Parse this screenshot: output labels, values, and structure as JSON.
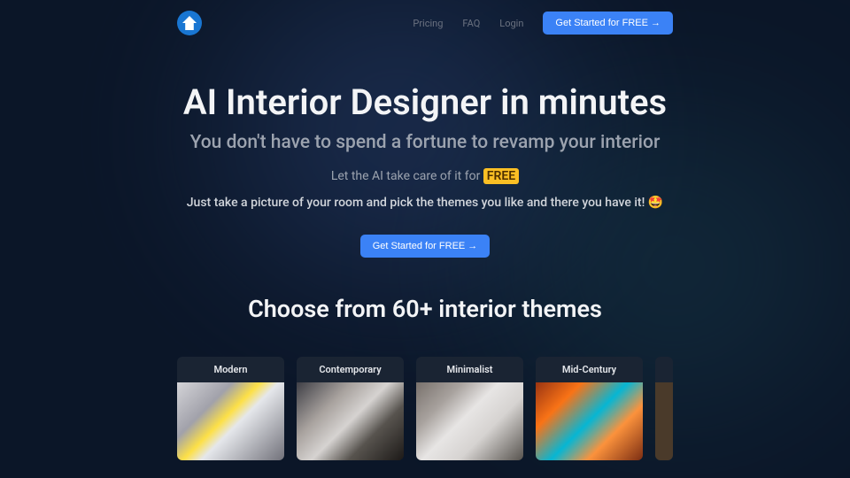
{
  "nav": {
    "pricing": "Pricing",
    "faq": "FAQ",
    "login": "Login",
    "cta": "Get Started for FREE →"
  },
  "hero": {
    "title": "AI Interior Designer in minutes",
    "subtitle": "You don't have to spend a fortune to revamp your interior",
    "line1_prefix": "Let the AI take care of it for ",
    "line1_highlight": "FREE",
    "line2": "Just take a picture of your room and pick the themes you like and there you have it!  🤩",
    "cta": "Get Started for FREE →"
  },
  "themes": {
    "title": "Choose from 60+ interior themes",
    "cards": [
      {
        "label": "Modern"
      },
      {
        "label": "Contemporary"
      },
      {
        "label": "Minimalist"
      },
      {
        "label": "Mid-Century"
      }
    ]
  }
}
